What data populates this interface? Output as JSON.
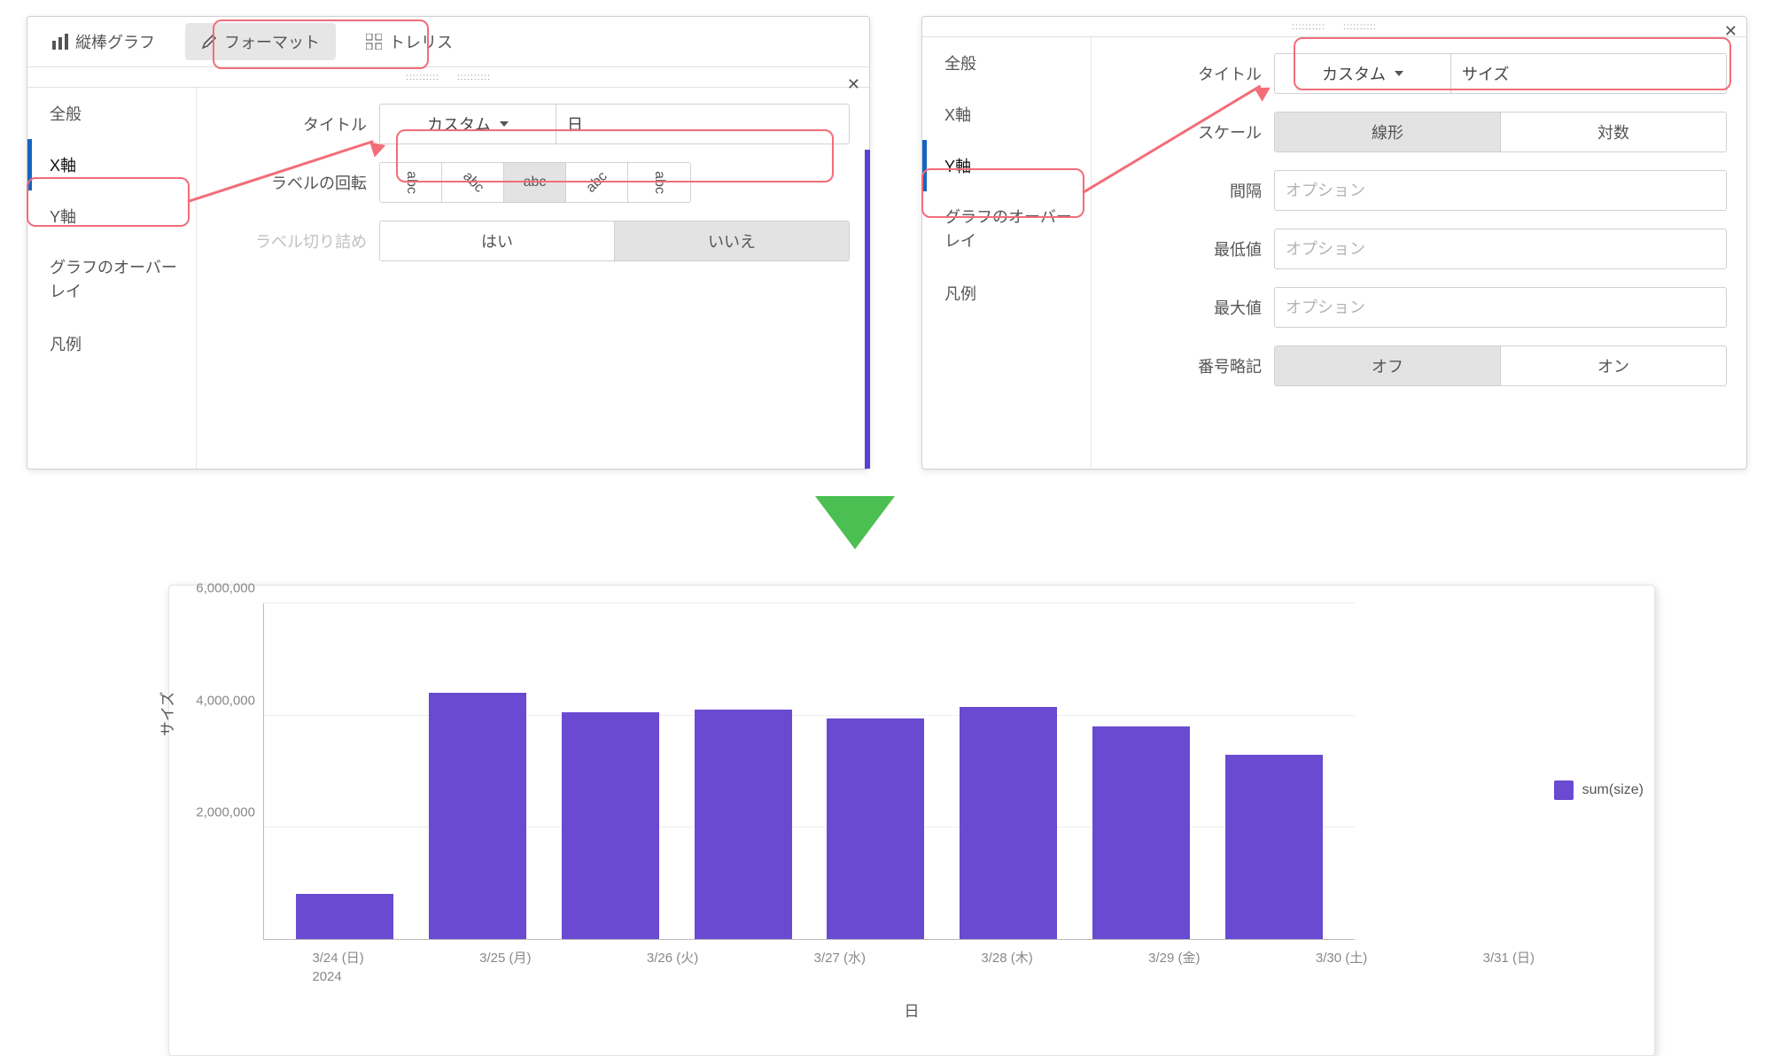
{
  "main_tabs": {
    "bar": "縦棒グラフ",
    "format": "フォーマット",
    "trellis": "トレリス"
  },
  "left_panel": {
    "side_items": [
      "全般",
      "X軸",
      "Y軸",
      "グラフのオーバーレイ",
      "凡例"
    ],
    "active_index": 1,
    "rows": {
      "title_label": "タイトル",
      "title_mode": "カスタム",
      "title_value": "日",
      "rotation_label": "ラベルの回転",
      "rotation_opts": [
        "abc",
        "abc",
        "abc",
        "abc",
        "abc"
      ],
      "trunc_label": "ラベル切り詰め",
      "trunc_yes": "はい",
      "trunc_no": "いいえ"
    }
  },
  "right_panel": {
    "side_items": [
      "全般",
      "X軸",
      "Y軸",
      "グラフのオーバーレイ",
      "凡例"
    ],
    "active_index": 2,
    "rows": {
      "title_label": "タイトル",
      "title_mode": "カスタム",
      "title_value": "サイズ",
      "scale_label": "スケール",
      "scale_linear": "線形",
      "scale_log": "対数",
      "interval_label": "間隔",
      "interval_placeholder": "オプション",
      "min_label": "最低値",
      "min_placeholder": "オプション",
      "max_label": "最大値",
      "max_placeholder": "オプション",
      "abbrev_label": "番号略記",
      "abbrev_off": "オフ",
      "abbrev_on": "オン"
    }
  },
  "chart_data": {
    "type": "bar",
    "title": "",
    "xlabel": "日",
    "ylabel": "サイズ",
    "ylim": [
      0,
      6000000
    ],
    "yticks": [
      "2,000,000",
      "4,000,000",
      "6,000,000"
    ],
    "categories": [
      "3/24 (日)\n2024",
      "3/25 (月)",
      "3/26 (火)",
      "3/27 (水)",
      "3/28 (木)",
      "3/29 (金)",
      "3/30 (土)",
      "3/31 (日)"
    ],
    "values": [
      800000,
      4400000,
      4050000,
      4100000,
      3950000,
      4150000,
      3800000,
      3300000
    ],
    "series_name": "sum(size)"
  }
}
